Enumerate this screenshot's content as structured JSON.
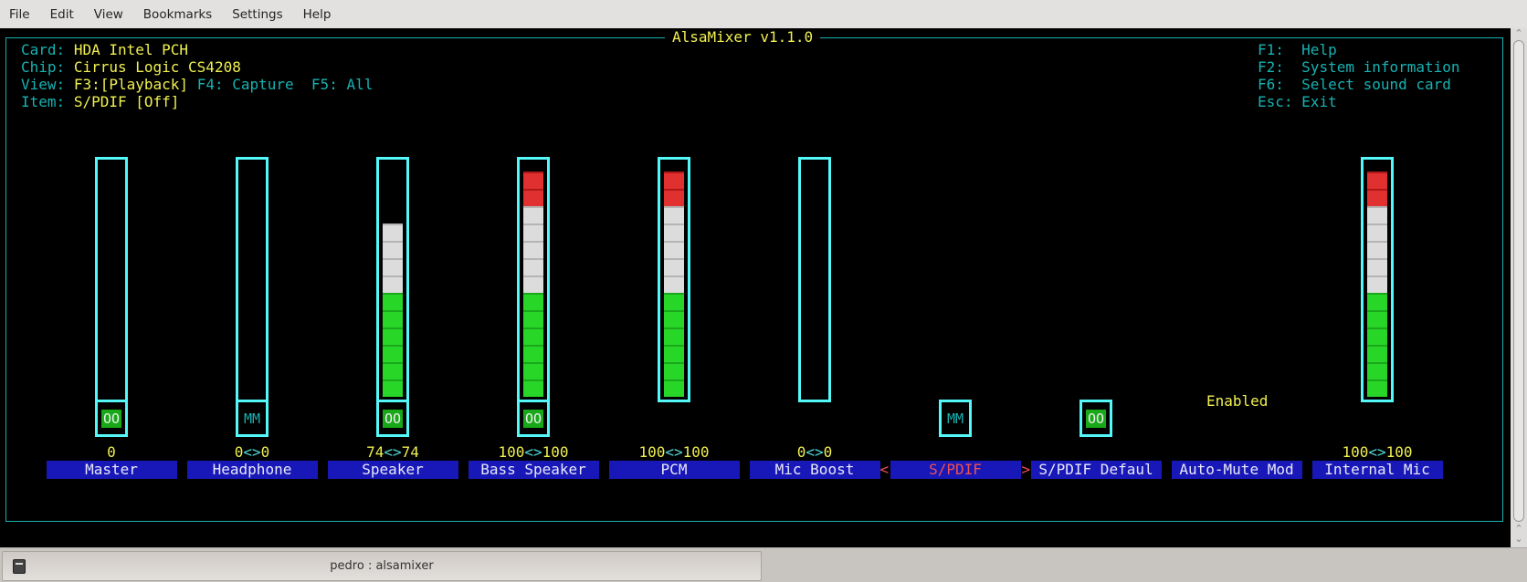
{
  "menubar": {
    "items": [
      "File",
      "Edit",
      "View",
      "Bookmarks",
      "Settings",
      "Help"
    ]
  },
  "mixer": {
    "title": "AlsaMixer v1.1.0",
    "info": {
      "card_label": "Card:",
      "card_value": "HDA Intel PCH",
      "chip_label": "Chip:",
      "chip_value": "Cirrus Logic CS4208",
      "view_label": "View:",
      "view_f3_key": "F3:",
      "view_f3_value": "[Playback]",
      "view_f4": "F4: Capture",
      "view_f5": "F5: All",
      "item_label": "Item:",
      "item_value": "S/PDIF [Off]"
    },
    "help": [
      {
        "key": "F1:",
        "action": "Help"
      },
      {
        "key": "F2:",
        "action": "System information"
      },
      {
        "key": "F6:",
        "action": "Select sound card"
      },
      {
        "key": "Esc:",
        "action": "Exit"
      }
    ],
    "controls": [
      {
        "name": "Master",
        "value_left": "0",
        "value_right": null,
        "level_percent": 0,
        "mute": "OO",
        "mute_state": "on"
      },
      {
        "name": "Headphone",
        "value_left": "0",
        "value_right": "0",
        "level_percent": 0,
        "mute": "MM",
        "mute_state": "muted"
      },
      {
        "name": "Speaker",
        "value_left": "74",
        "value_right": "74",
        "level_percent": 74,
        "mute": "OO",
        "mute_state": "on"
      },
      {
        "name": "Bass Speaker",
        "value_left": "100",
        "value_right": "100",
        "level_percent": 100,
        "mute": "OO",
        "mute_state": "on"
      },
      {
        "name": "PCM",
        "value_left": "100",
        "value_right": "100",
        "level_percent": 100,
        "mute": null,
        "mute_state": null
      },
      {
        "name": "Mic Boost",
        "value_left": "0",
        "value_right": "0",
        "level_percent": 0,
        "mute": null,
        "mute_state": null
      },
      {
        "name": "S/PDIF",
        "value_left": null,
        "value_right": null,
        "level_percent": null,
        "mute": "MM",
        "mute_state": "muted",
        "selected": true
      },
      {
        "name": "S/PDIF Defaul",
        "value_left": null,
        "value_right": null,
        "level_percent": null,
        "mute": "OO",
        "mute_state": "on"
      },
      {
        "name": "Auto-Mute Mod",
        "value_left": null,
        "value_right": null,
        "level_percent": null,
        "mute": null,
        "mute_state": null,
        "enum_value": "Enabled"
      },
      {
        "name": "Internal Mic",
        "value_left": "100",
        "value_right": "100",
        "level_percent": 100,
        "mute": null,
        "mute_state": null
      }
    ],
    "value_separator": "<>",
    "select_left": "<",
    "select_right": ">"
  },
  "taskbar": {
    "task_label": "pedro : alsamixer"
  },
  "scrollbar": {
    "up": "^",
    "down": "v"
  }
}
